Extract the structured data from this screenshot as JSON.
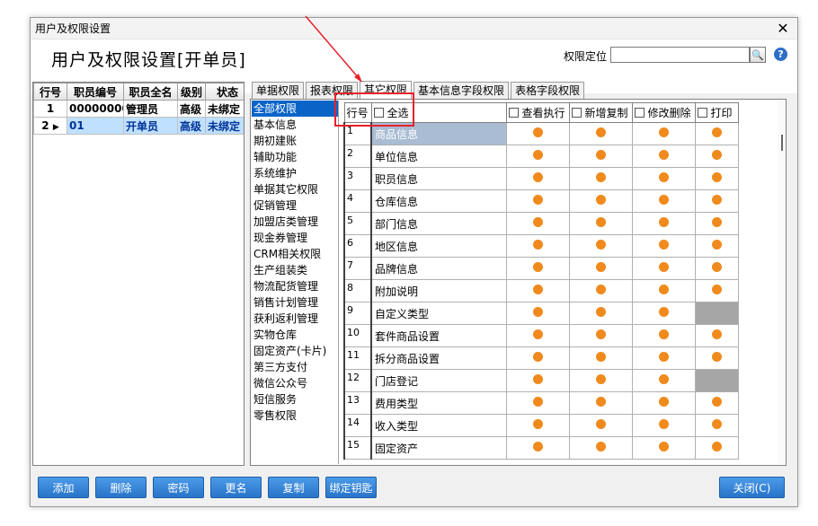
{
  "window": {
    "title": "用户及权限设置"
  },
  "header": {
    "page_title": "用户及权限设置[开单员]",
    "locate_label": "权限定位",
    "locate_value": "",
    "search_icon": "search-icon",
    "help_icon": "help-icon"
  },
  "users": {
    "headers": [
      "行号",
      "职员编号",
      "职员全名",
      "级别",
      "状态"
    ],
    "rows": [
      {
        "rownum": "1",
        "code": "00000000",
        "name": "管理员",
        "level": "高级",
        "status": "未绑定"
      },
      {
        "rownum": "2",
        "code": "01",
        "name": "开单员",
        "level": "高级",
        "status": "未绑定"
      }
    ]
  },
  "tabs": [
    "单据权限",
    "报表权限",
    "其它权限",
    "基本信息字段权限",
    "表格字段权限"
  ],
  "categories": [
    "全部权限",
    "基本信息",
    "期初建账",
    "辅助功能",
    "系统维护",
    "单据其它权限",
    "促销管理",
    "加盟店类管理",
    "现金券管理",
    "CRM相关权限",
    "生产组装类",
    "物流配货管理",
    "销售计划管理",
    "获利返利管理",
    "实物仓库",
    "固定资产(卡片)",
    "第三方支付",
    "微信公众号",
    "短信服务",
    "零售权限"
  ],
  "grid": {
    "headers": {
      "rownum": "行号",
      "select_all": "全选",
      "view": "查看执行",
      "add": "新增复制",
      "edit": "修改删除",
      "print": "打印"
    },
    "rows": [
      {
        "n": "1",
        "name": "商品信息",
        "print": true
      },
      {
        "n": "2",
        "name": "单位信息",
        "print": true
      },
      {
        "n": "3",
        "name": "职员信息",
        "print": true
      },
      {
        "n": "4",
        "name": "仓库信息",
        "print": true
      },
      {
        "n": "5",
        "name": "部门信息",
        "print": true
      },
      {
        "n": "6",
        "name": "地区信息",
        "print": true
      },
      {
        "n": "7",
        "name": "品牌信息",
        "print": true
      },
      {
        "n": "8",
        "name": "附加说明",
        "print": true
      },
      {
        "n": "9",
        "name": "自定义类型",
        "print": false
      },
      {
        "n": "10",
        "name": "套件商品设置",
        "print": true
      },
      {
        "n": "11",
        "name": "拆分商品设置",
        "print": true
      },
      {
        "n": "12",
        "name": "门店登记",
        "print": false
      },
      {
        "n": "13",
        "name": "费用类型",
        "print": true
      },
      {
        "n": "14",
        "name": "收入类型",
        "print": true
      },
      {
        "n": "15",
        "name": "固定资产",
        "print": true
      }
    ]
  },
  "buttons": {
    "add": "添加",
    "delete": "删除",
    "password": "密码",
    "rename": "更名",
    "copy": "复制",
    "bind_key": "绑定钥匙",
    "close": "关闭(C)"
  },
  "colors": {
    "button_blue": "#2f7ed4",
    "dot_orange": "#f08a1c",
    "selection_blue": "#0a64c8",
    "annotation_red": "#e8202a"
  }
}
